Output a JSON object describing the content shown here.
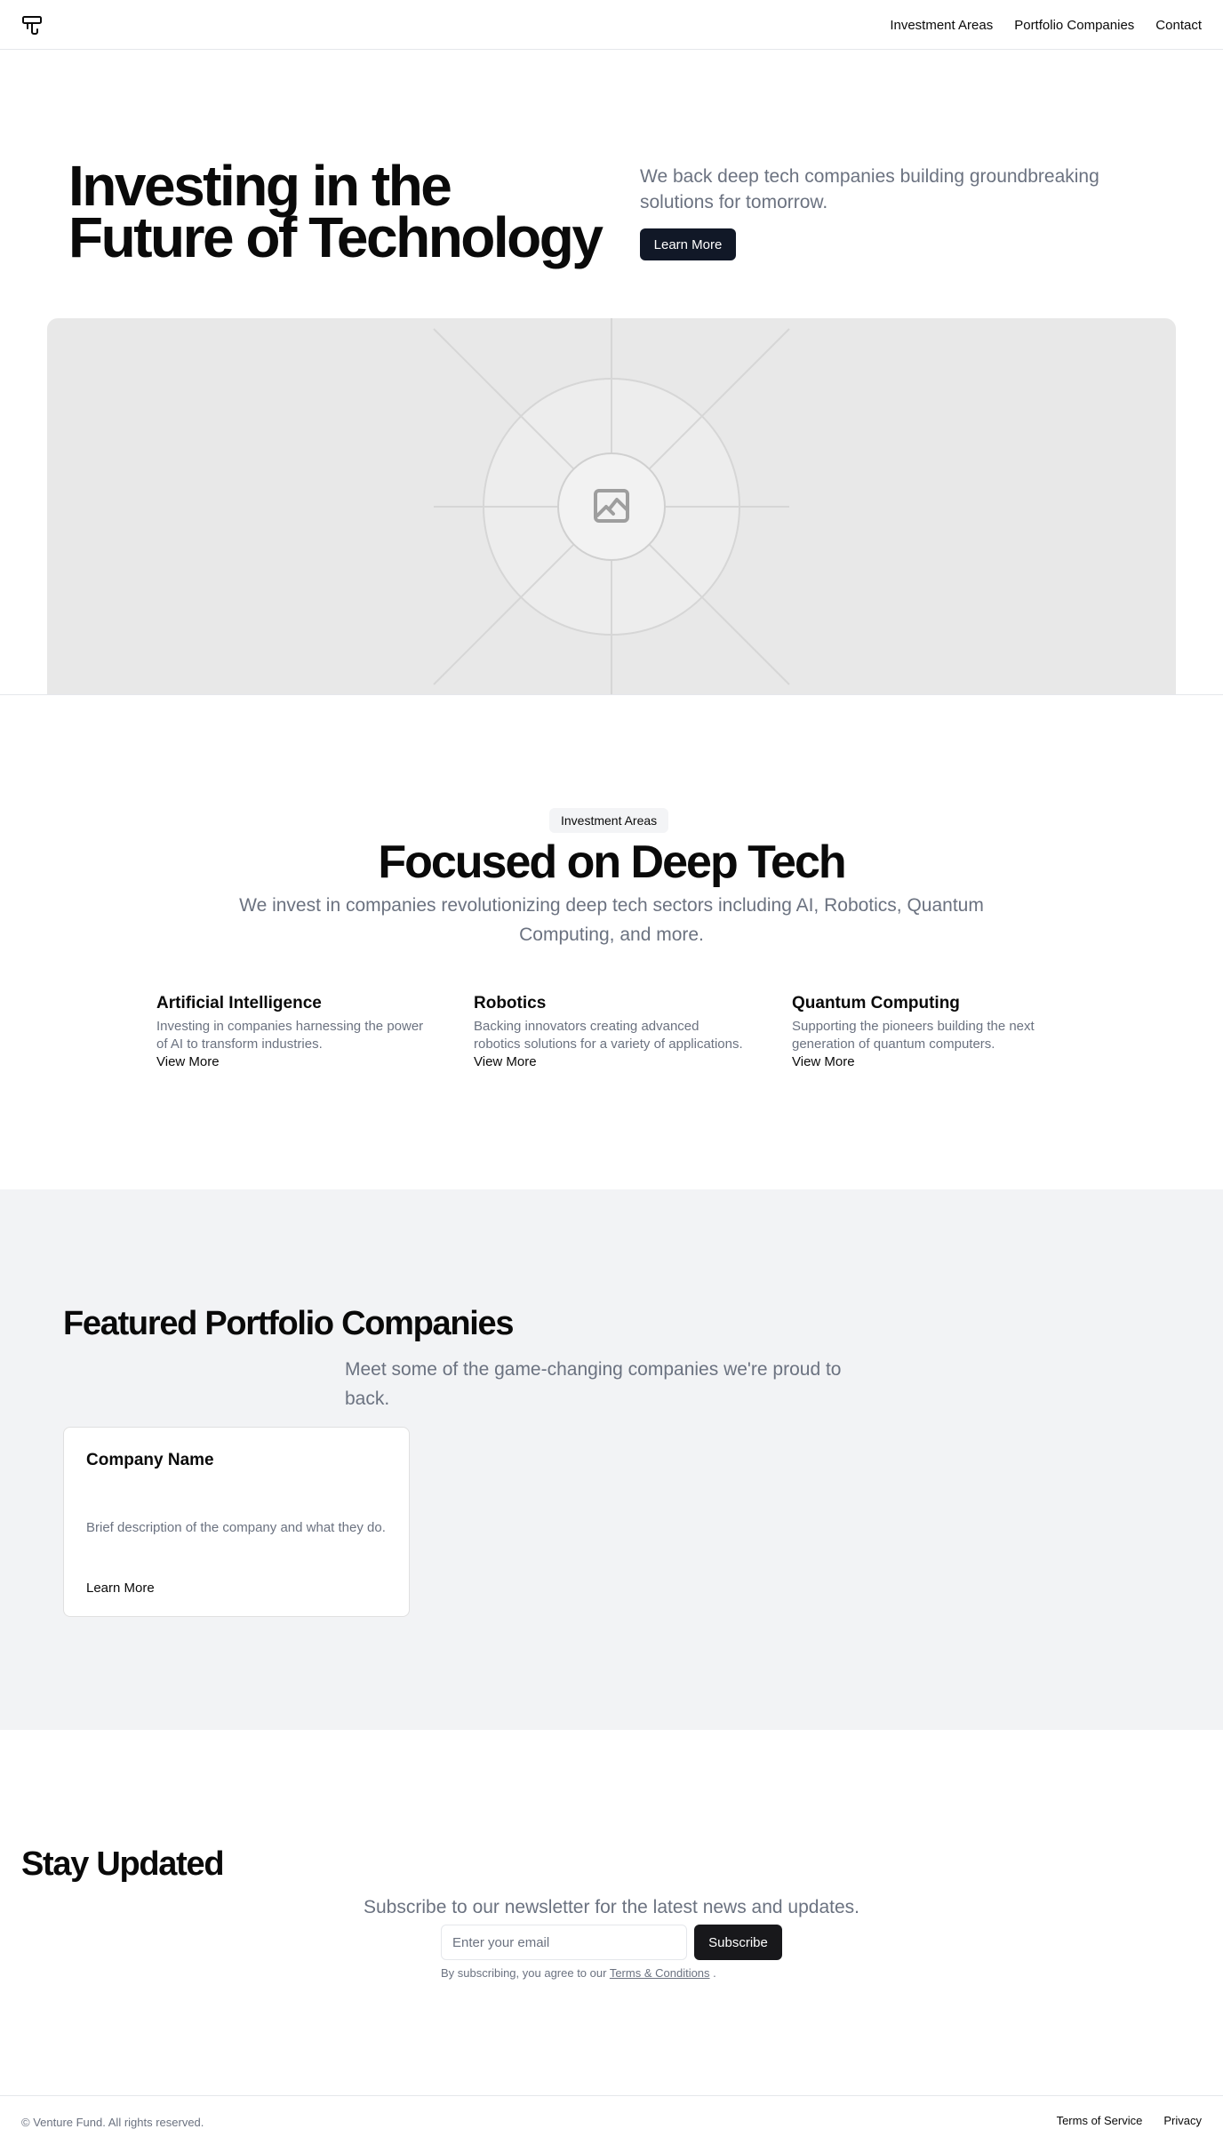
{
  "nav": {
    "items": [
      "Investment Areas",
      "Portfolio Companies",
      "Contact"
    ]
  },
  "hero": {
    "title": "Investing in the Future of Technology",
    "subtitle": "We back deep tech companies building groundbreaking solutions for tomorrow.",
    "cta": "Learn More",
    "image_icon": "image-placeholder-icon"
  },
  "areas": {
    "badge": "Investment Areas",
    "title": "Focused on Deep Tech",
    "subtitle": "We invest in companies revolutionizing deep tech sectors including AI, Robotics, Quantum Computing, and more.",
    "items": [
      {
        "title": "Artificial Intelligence",
        "description": "Investing in companies harnessing the power of AI to transform industries.",
        "link": "View More"
      },
      {
        "title": "Robotics",
        "description": "Backing innovators creating advanced robotics solutions for a variety of applications.",
        "link": "View More"
      },
      {
        "title": "Quantum Computing",
        "description": "Supporting the pioneers building the next generation of quantum computers.",
        "link": "View More"
      }
    ]
  },
  "portfolio": {
    "title": "Featured Portfolio Companies",
    "subtitle": "Meet some of the game-changing companies we're proud to back.",
    "card": {
      "name": "Company Name",
      "description": "Brief description of the company and what they do.",
      "link": "Learn More"
    }
  },
  "newsletter": {
    "title": "Stay Updated",
    "subtitle": "Subscribe to our newsletter for the latest news and updates.",
    "placeholder": "Enter your email",
    "button": "Subscribe",
    "legal_prefix": "By subscribing, you agree to our",
    "legal_link": "Terms & Conditions",
    "legal_suffix": "."
  },
  "footer": {
    "copyright": "© Venture Fund. All rights reserved.",
    "links": [
      "Terms of Service",
      "Privacy"
    ]
  },
  "colors": {
    "primary_dark": "#111827",
    "muted_text": "#6b7280",
    "section_bg": "#f2f3f5"
  }
}
